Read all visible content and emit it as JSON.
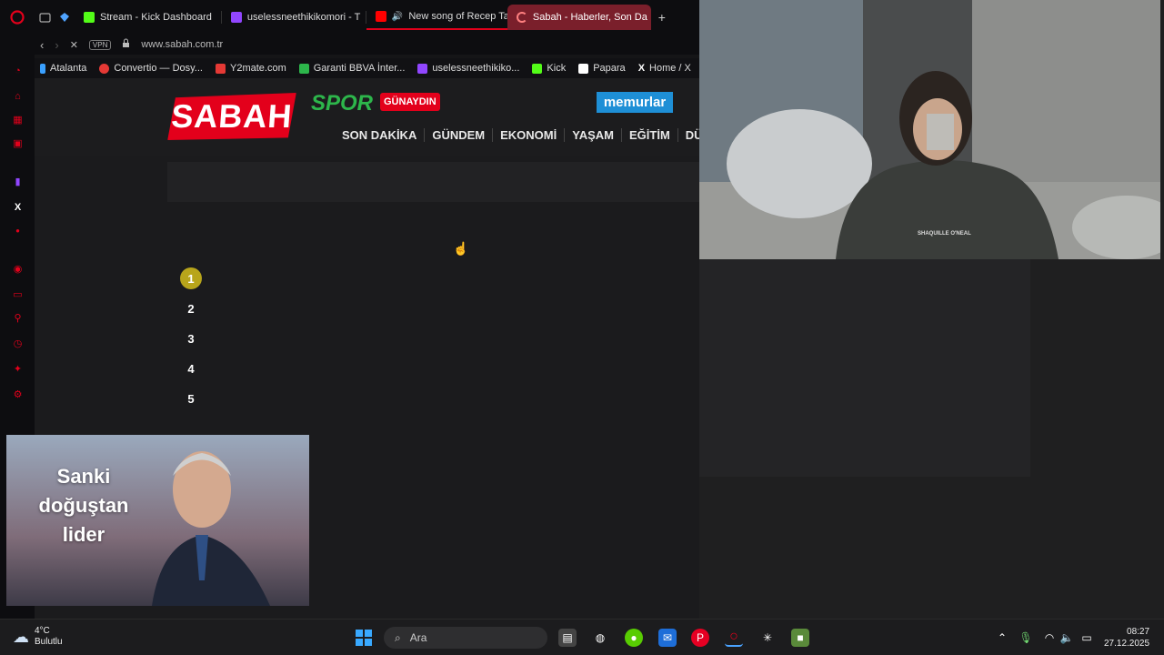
{
  "browser": {
    "tabs": [
      {
        "label": "Stream - Kick Dashboard",
        "color": "#53fc18"
      },
      {
        "label": "uselessneethikikomori - T",
        "color": "#9146ff"
      },
      {
        "label": "New song of Recep Ta",
        "color": "#ff0000"
      },
      {
        "label": "Sabah - Haberler, Son Da",
        "color": "#ff4d4d"
      }
    ],
    "new_tab_label": "+",
    "vpn_label": "VPN",
    "url": "www.sabah.com.tr",
    "bookmarks": [
      {
        "label": "Atalanta",
        "color": "#3aa0ff"
      },
      {
        "label": "Convertio — Dosy...",
        "color": "#e53935"
      },
      {
        "label": "Y2mate.com",
        "color": "#e53935"
      },
      {
        "label": "Garanti BBVA İnter...",
        "color": "#2db64b"
      },
      {
        "label": "uselessneethikiko...",
        "color": "#9146ff"
      },
      {
        "label": "Kick",
        "color": "#53fc18"
      },
      {
        "label": "Papara",
        "color": "#ffffff"
      },
      {
        "label": "Home / X",
        "color": "#ffffff"
      }
    ]
  },
  "site": {
    "logo": "SABAH",
    "spor": "SPOR",
    "gunaydin": "GÜNAYDIN",
    "memurlar": "memurlar",
    "nav": [
      "SON DAKİKA",
      "GÜNDEM",
      "EKONOMİ",
      "YAŞAM",
      "EĞİTİM",
      "DÜ"
    ],
    "list_numbers": [
      "1",
      "2",
      "3",
      "4",
      "5"
    ]
  },
  "webcam": {
    "shirt_text": "SHAQUILLE O'NEAL"
  },
  "promo": {
    "text": "Sanki doğuştan lider"
  },
  "taskbar": {
    "weather_temp": "4°C",
    "weather_desc": "Bulutlu",
    "search_placeholder": "Ara",
    "time": "08:27",
    "date": "27.12.2025"
  }
}
